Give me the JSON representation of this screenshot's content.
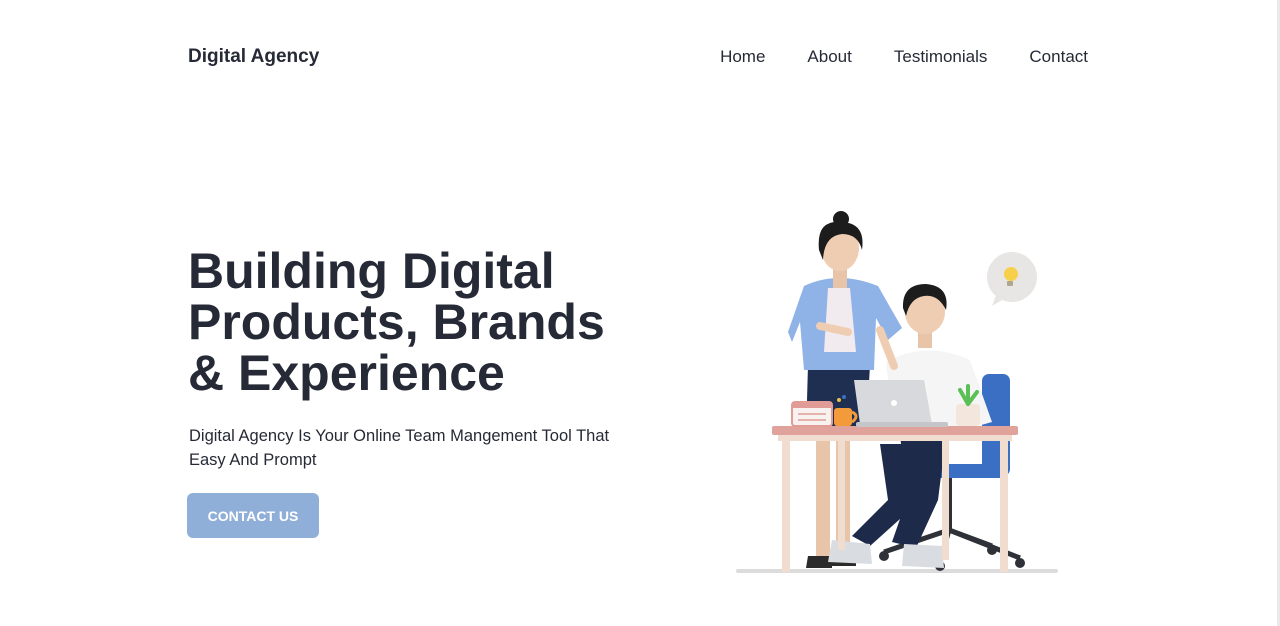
{
  "brand": "Digital Agency",
  "nav": [
    "Home",
    "About",
    "Testimonials",
    "Contact"
  ],
  "hero": {
    "title_lines": [
      "Building Digital",
      "Products, Brands",
      "& Experience"
    ],
    "subtitle_lines": [
      "Digital Agency Is Your Online Team Mangement Tool That",
      "Easy And Prompt"
    ],
    "cta": "CONTACT US"
  },
  "illustration": {
    "icons": [
      "lightbulb-icon",
      "laptop-icon",
      "calendar-icon",
      "mug-icon",
      "plant-icon"
    ]
  },
  "colors": {
    "text": "#262a36",
    "accent": "#90afd8",
    "background": "#ffffff"
  }
}
